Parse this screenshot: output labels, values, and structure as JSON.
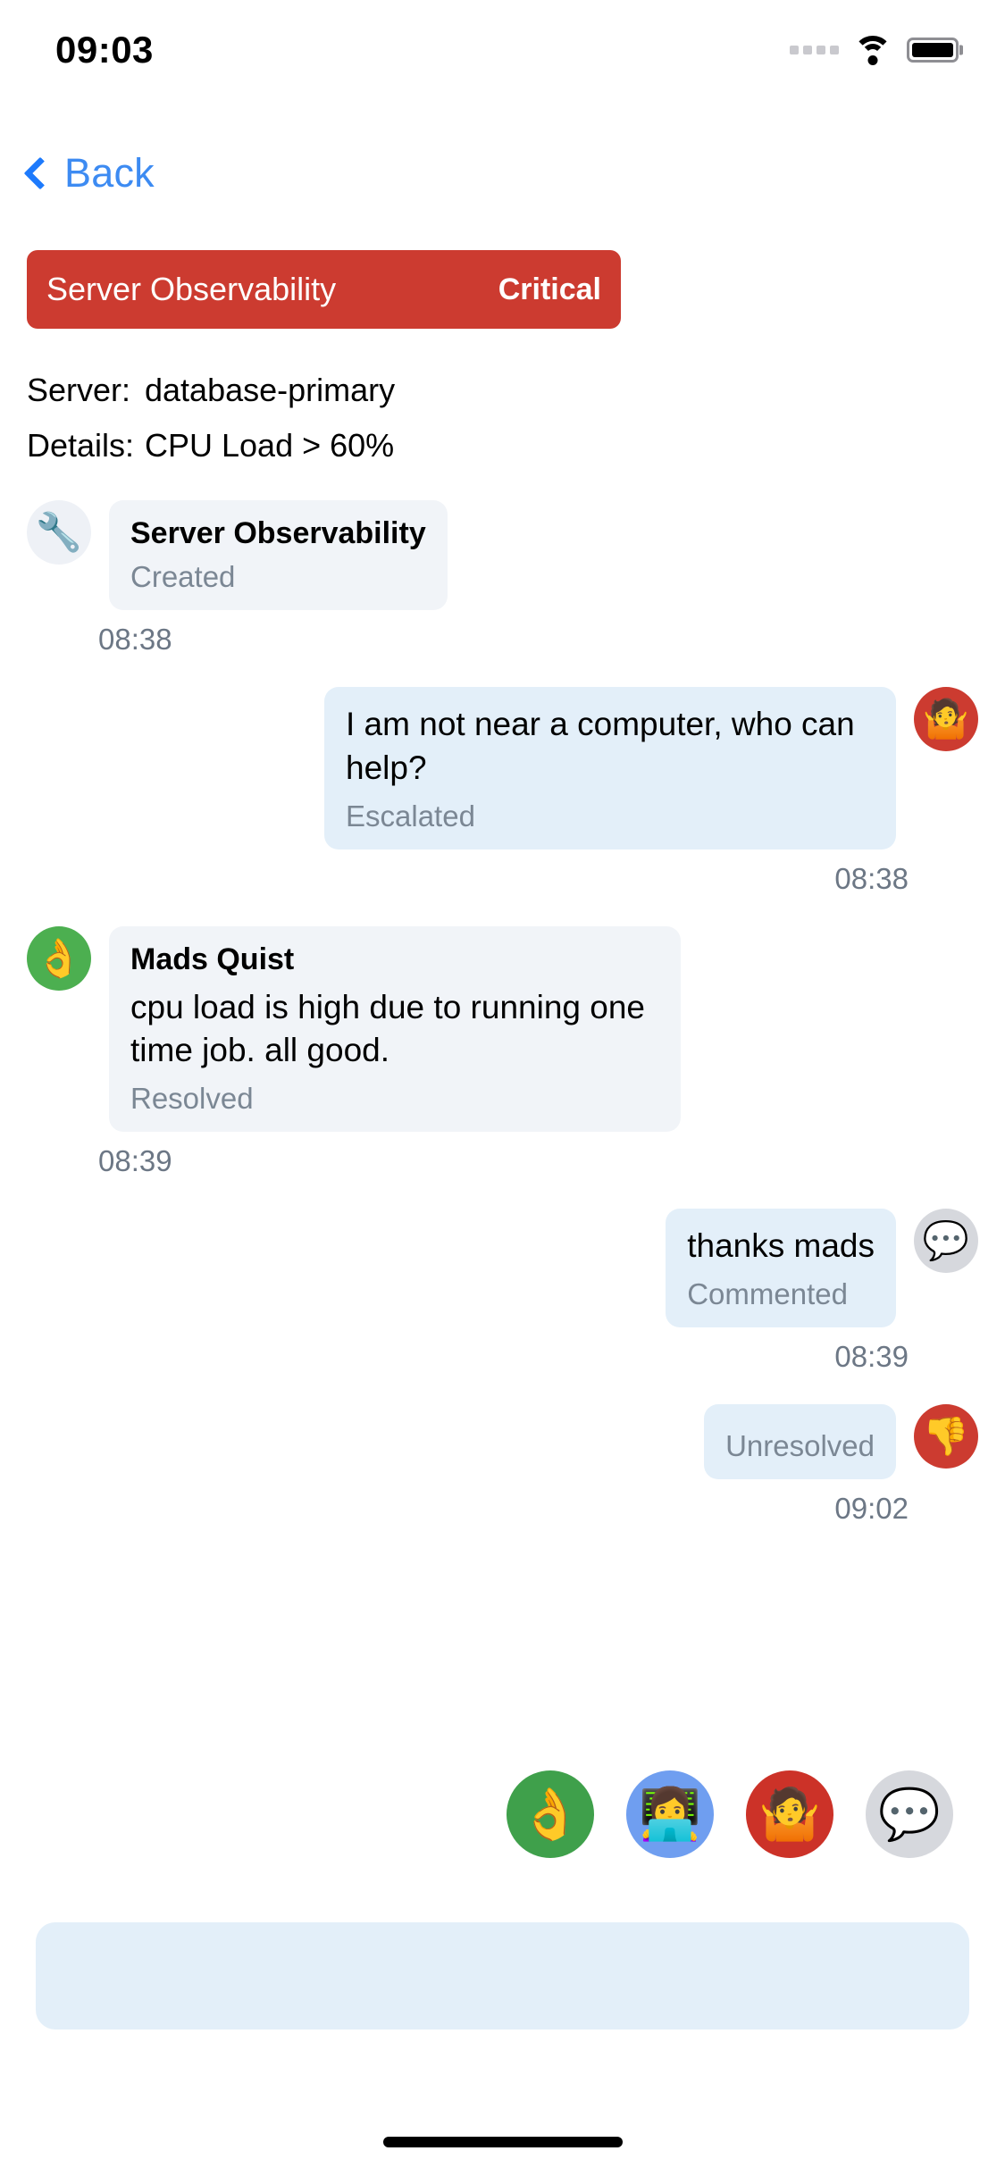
{
  "status_bar": {
    "time": "09:03",
    "cellular_icon": "signal-dots-icon",
    "wifi_icon": "wifi-icon",
    "battery_icon": "battery-full-icon"
  },
  "nav": {
    "back_label": "Back",
    "back_icon": "chevron-left-icon",
    "accent_color": "#3d8bf2"
  },
  "alert_banner": {
    "title": "Server Observability",
    "severity": "Critical",
    "background_color": "#cc3b30",
    "text_color": "#ffffff"
  },
  "details": {
    "server_key": "Server:",
    "server_value": "database-primary",
    "details_key": "Details:",
    "details_value": "CPU Load > 60%"
  },
  "thread": {
    "messages": [
      {
        "side": "in",
        "avatar_icon": "wrench-emoji-avatar",
        "avatar_glyph": "🔧",
        "avatar_bg": "#eef1f6",
        "name": "Server Observability",
        "text": "",
        "status": "Created",
        "time": "08:38",
        "bubble_color": "#f1f4f8"
      },
      {
        "side": "out",
        "avatar_icon": "shrug-emoji-avatar",
        "avatar_glyph": "🤷",
        "avatar_bg": "#cc3b30",
        "name": "",
        "text": "I am not near a computer, who can help?",
        "status": "Escalated",
        "time": "08:38",
        "bubble_color": "#e3eff9"
      },
      {
        "side": "in",
        "avatar_icon": "ok-hand-emoji-avatar",
        "avatar_glyph": "👌",
        "avatar_bg": "#4caf50",
        "name": "Mads Quist",
        "text": "cpu load is high due to running one time job. all good.",
        "status": "Resolved",
        "time": "08:39",
        "bubble_color": "#f1f4f8"
      },
      {
        "side": "out",
        "avatar_icon": "speech-balloon-emoji-avatar",
        "avatar_glyph": "💬",
        "avatar_bg": "#d6d8dd",
        "name": "",
        "text": "thanks mads",
        "status": "Commented",
        "time": "08:39",
        "bubble_color": "#e3eff9"
      },
      {
        "side": "out",
        "avatar_icon": "thumbs-down-emoji-avatar",
        "avatar_glyph": "👎",
        "avatar_bg": "#cc3b30",
        "name": "",
        "text": "",
        "status": "Unresolved",
        "time": "09:02",
        "bubble_color": "#e3eff9"
      }
    ]
  },
  "reaction_picker": {
    "items": [
      {
        "icon": "ok-hand-reaction",
        "glyph": "👌",
        "bg": "#3fa04b"
      },
      {
        "icon": "woman-technologist-reaction",
        "glyph": "👩‍💻",
        "bg": "#6f9ef0"
      },
      {
        "icon": "shrug-reaction",
        "glyph": "🤷",
        "bg": "#cc3228"
      },
      {
        "icon": "speech-balloon-reaction",
        "glyph": "💬",
        "bg": "#d6d8dd"
      }
    ]
  },
  "composer": {
    "value": "",
    "placeholder": "",
    "background_color": "#e3eff9"
  }
}
